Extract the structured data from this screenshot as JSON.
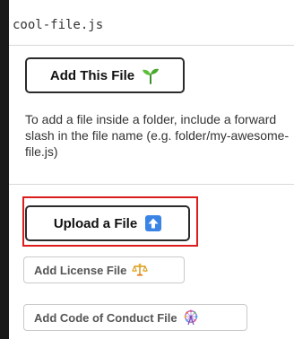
{
  "filename_input": {
    "value": "cool-file.js"
  },
  "add_file_button": {
    "label": "Add This File",
    "icon": "sprout-icon"
  },
  "hint_text": "To add a file inside a folder, include a forward slash in the file name (e.g. folder/my-awesome-file.js)",
  "upload_button": {
    "label": "Upload a File",
    "icon": "upload-arrow-icon",
    "icon_color": "#3a84e6"
  },
  "license_button": {
    "label": "Add License File",
    "icon": "scales-icon"
  },
  "coc_button": {
    "label": "Add Code of Conduct File",
    "icon": "ferris-wheel-icon"
  },
  "highlight_color": "#dd1c1c"
}
